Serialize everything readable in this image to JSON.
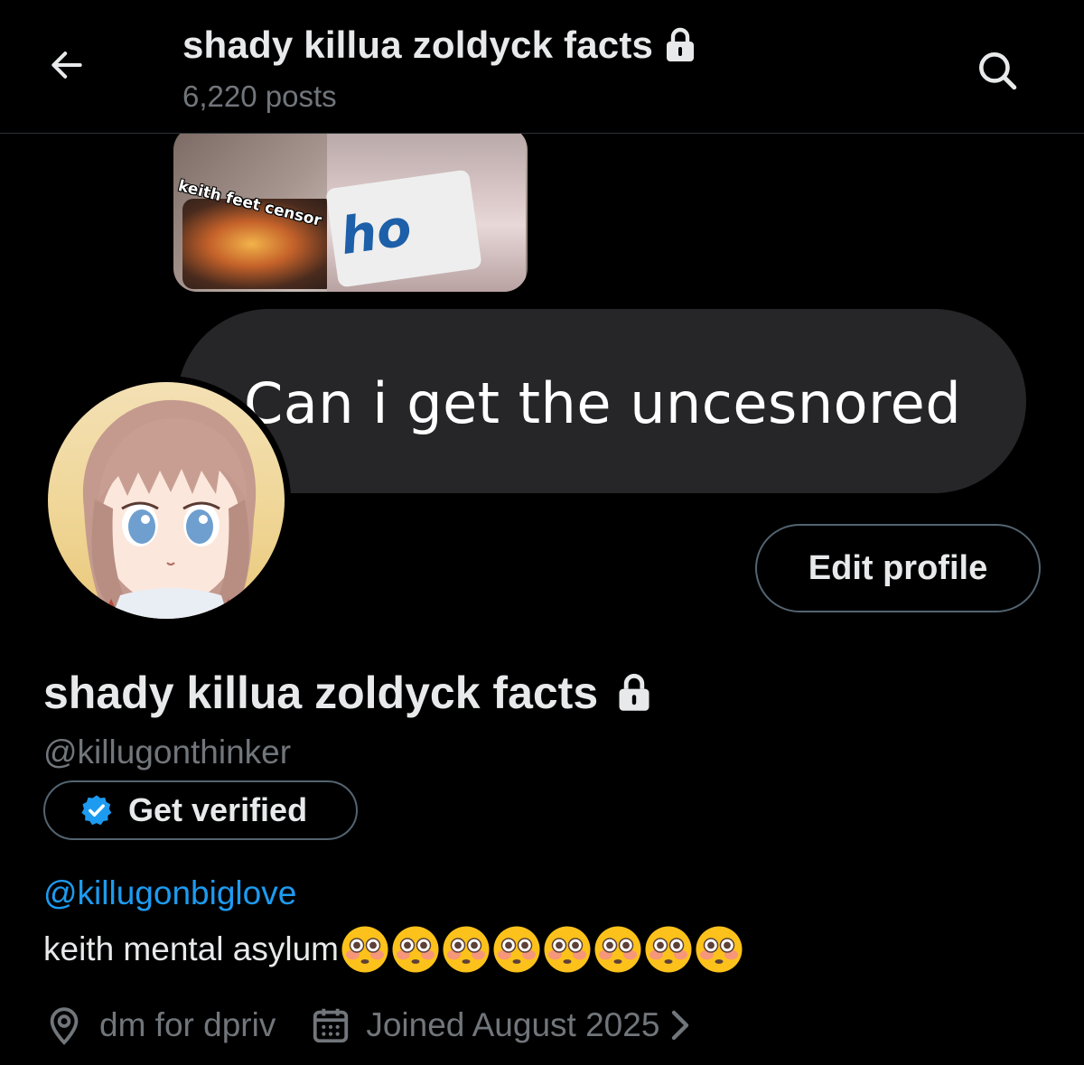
{
  "header": {
    "title": "shady killua zoldyck facts",
    "posts_count": "6,220 posts"
  },
  "banner": {
    "photo_caption": "keith feet censor",
    "photo_logo": "ho",
    "message_text": "Can i get the uncesnored"
  },
  "profile": {
    "display_name": "shady killua zoldyck facts",
    "handle": "@killugonthinker",
    "edit_profile_label": "Edit profile",
    "get_verified_label": "Get verified",
    "bio_mention": "@killugonbiglove",
    "bio_text": "keith mental asylum",
    "bio_emojis": [
      "flushed-face",
      "flushed-face",
      "flushed-face",
      "flushed-face",
      "flushed-face",
      "flushed-face",
      "flushed-face",
      "flushed-face"
    ],
    "location": "dm for dpriv",
    "joined": "Joined August 2025"
  },
  "colors": {
    "background": "#000000",
    "text_primary": "#e7e9ea",
    "text_secondary": "#71767b",
    "link": "#1d9bf0",
    "border": "#536471",
    "verified_badge": "#1d9bf0"
  }
}
